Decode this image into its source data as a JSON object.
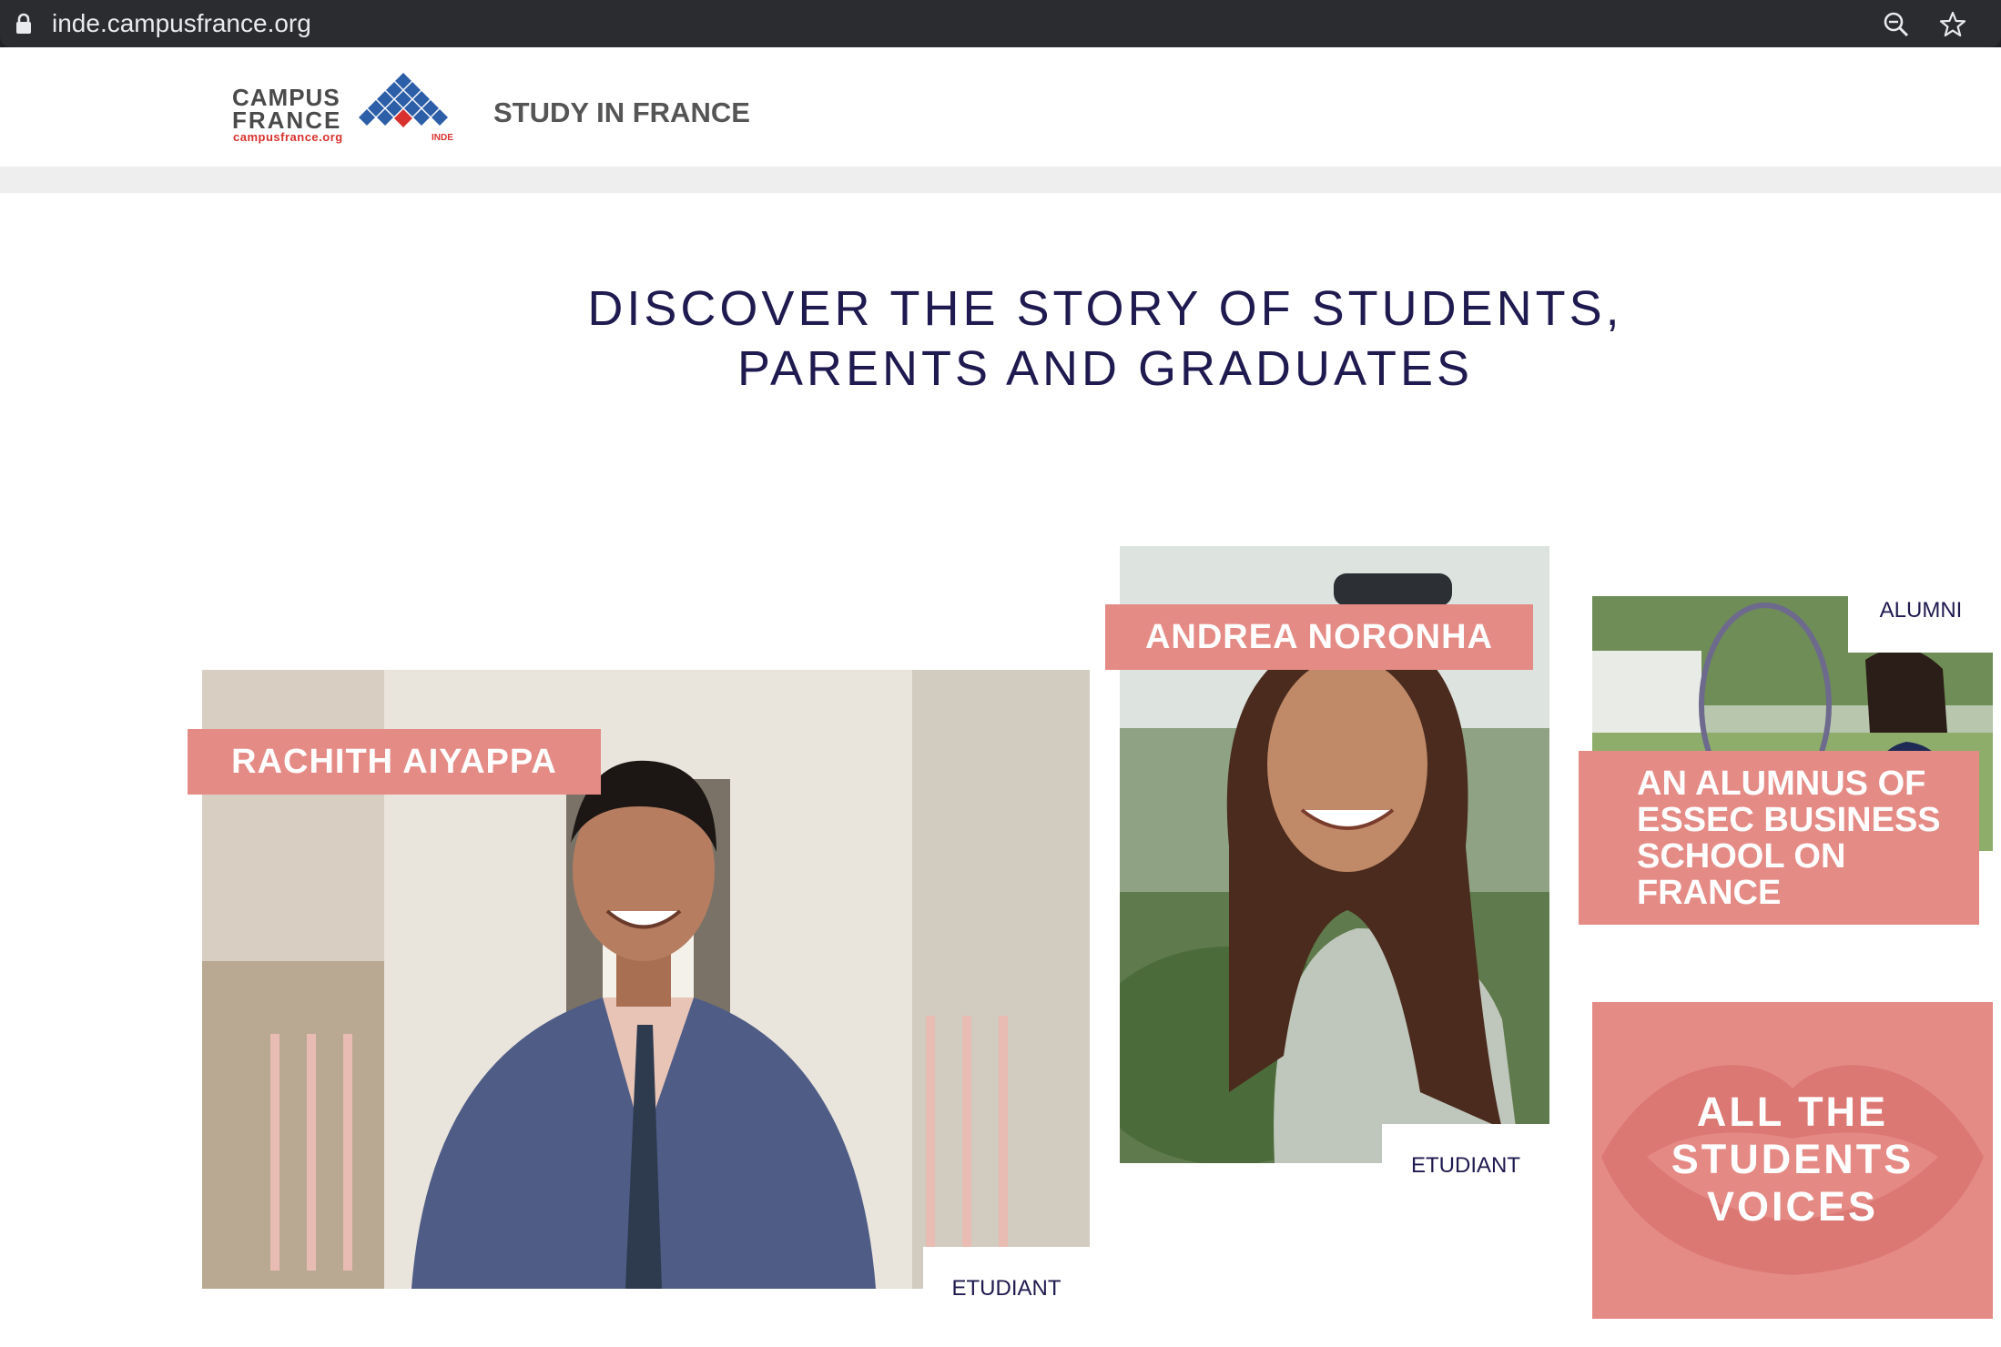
{
  "browser": {
    "url": "inde.campusfrance.org"
  },
  "header": {
    "logo_word_1": "CAMPUS",
    "logo_word_2": "FRANCE",
    "logo_url": "campusfrance.org",
    "logo_country": "INDE",
    "site_name": "STUDY IN FRANCE"
  },
  "page": {
    "title_line_1": "DISCOVER THE STORY OF STUDENTS,",
    "title_line_2": "PARENTS AND GRADUATES"
  },
  "stories": [
    {
      "name": "RACHITH AIYAPPA",
      "type": "ETUDIANT"
    },
    {
      "name": "ANDREA NORONHA",
      "type": "ETUDIANT"
    },
    {
      "type": "ALUMNI",
      "title_lines": [
        "AN ALUMNUS OF",
        "ESSEC BUSINESS",
        "SCHOOL ON",
        "FRANCE"
      ]
    }
  ],
  "voices": {
    "label_lines": [
      "ALL THE",
      "STUDENTS",
      "VOICES"
    ]
  },
  "colors": {
    "accent": "#e58b86",
    "heading": "#1f1a4f",
    "logo_blue": "#2d5fa8",
    "logo_red": "#d9322e"
  }
}
